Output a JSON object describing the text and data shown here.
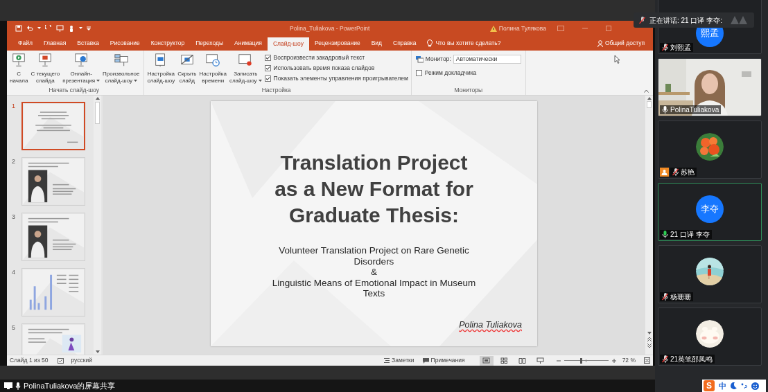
{
  "call": {
    "speaking_banner": "正在讲话: 21 口译 李夺:"
  },
  "powerpoint": {
    "title": "Polina_Tuliakova - PowerPoint",
    "account_warning": "Полина Тулякова",
    "tabs": [
      {
        "label": "Файл",
        "selected": false
      },
      {
        "label": "Главная",
        "selected": false
      },
      {
        "label": "Вставка",
        "selected": false
      },
      {
        "label": "Рисование",
        "selected": false
      },
      {
        "label": "Конструктор",
        "selected": false
      },
      {
        "label": "Переходы",
        "selected": false
      },
      {
        "label": "Анимация",
        "selected": false
      },
      {
        "label": "Слайд-шоу",
        "selected": true
      },
      {
        "label": "Рецензирование",
        "selected": false
      },
      {
        "label": "Вид",
        "selected": false
      },
      {
        "label": "Справка",
        "selected": false
      }
    ],
    "tell_me": "Что вы хотите сделать?",
    "share": "Общий доступ",
    "ribbon": {
      "start_group": {
        "label": "Начать слайд-шоу",
        "buttons": [
          {
            "kind": "from_start",
            "lines": [
              "С",
              "начала"
            ],
            "dropdown": false
          },
          {
            "kind": "from_current",
            "lines": [
              "С текущего",
              "слайда"
            ],
            "dropdown": false
          },
          {
            "kind": "online",
            "lines": [
              "Онлайн-",
              "презентация"
            ],
            "dropdown": true
          },
          {
            "kind": "custom",
            "lines": [
              "Произвольное",
              "слайд-шоу"
            ],
            "dropdown": true
          }
        ]
      },
      "setup_group": {
        "label": "Настройка",
        "buttons": [
          {
            "kind": "setup",
            "lines": [
              "Настройка",
              "слайд-шоу"
            ],
            "dropdown": false
          },
          {
            "kind": "hide",
            "lines": [
              "Скрыть",
              "слайд"
            ],
            "dropdown": false
          },
          {
            "kind": "timing",
            "lines": [
              "Настройка",
              "времени"
            ],
            "dropdown": false
          },
          {
            "kind": "record",
            "lines": [
              "Записать",
              "слайд-шоу"
            ],
            "dropdown": true
          }
        ],
        "checkboxes": [
          {
            "label": "Воспроизвести закадровый текст",
            "checked": true
          },
          {
            "label": "Использовать время показа слайдов",
            "checked": true
          },
          {
            "label": "Показать элементы управления проигрывателем",
            "checked": true
          }
        ]
      },
      "monitors_group": {
        "label": "Мониторы",
        "monitor_label": "Монитор:",
        "monitor_value": "Автоматически",
        "presenter_view": {
          "label": "Режим докладчика",
          "checked": false
        }
      }
    },
    "thumbnails": [
      {
        "number": "1",
        "selected": true,
        "kind": "title"
      },
      {
        "number": "2",
        "selected": false,
        "kind": "portrait"
      },
      {
        "number": "3",
        "selected": false,
        "kind": "portrait"
      },
      {
        "number": "4",
        "selected": false,
        "kind": "chart"
      },
      {
        "number": "5",
        "selected": false,
        "kind": "illustration"
      }
    ],
    "slide": {
      "title_lines": [
        "Translation Project",
        "as a New Format for",
        "Graduate Thesis:"
      ],
      "subtitle": [
        "Volunteer Translation Project on Rare Genetic Disorders",
        "&",
        "Linguistic Means of Emotional Impact in Museum Texts"
      ],
      "author": "Polina Tuliakova"
    },
    "status_bar": {
      "slide_info": "Слайд 1 из 50",
      "language": "русский",
      "notes": "Заметки",
      "comments": "Примечания",
      "views": [
        {
          "kind": "normal",
          "selected": true
        },
        {
          "kind": "sorter",
          "selected": false
        },
        {
          "kind": "reading",
          "selected": false
        },
        {
          "kind": "slideshow",
          "selected": false
        }
      ],
      "zoom": {
        "level": 0.38,
        "reading": "72 %"
      }
    }
  },
  "participants": [
    {
      "kind": "initials",
      "initials": "熙孟",
      "name": "刘熙孟",
      "muted": true,
      "speaking": false,
      "host": false
    },
    {
      "kind": "video",
      "name": "PolinaTuliakova",
      "muted": false,
      "speaking": false,
      "host": false
    },
    {
      "kind": "flowers",
      "name": "苏艳",
      "muted": true,
      "speaking": false,
      "host": true
    },
    {
      "kind": "initials",
      "initials": "李夺",
      "name": "21 口译 李夺",
      "muted": false,
      "speaking": true,
      "host": false
    },
    {
      "kind": "beach",
      "name": "杨珊珊",
      "muted": true,
      "speaking": false,
      "host": false
    },
    {
      "kind": "toy",
      "name": "21英笔邵凤鸣",
      "muted": true,
      "speaking": false,
      "host": false
    }
  ],
  "screen_share_label": "PolinaTuliakova的屏幕共享",
  "tray": {
    "logo": "S",
    "ime": "中"
  }
}
